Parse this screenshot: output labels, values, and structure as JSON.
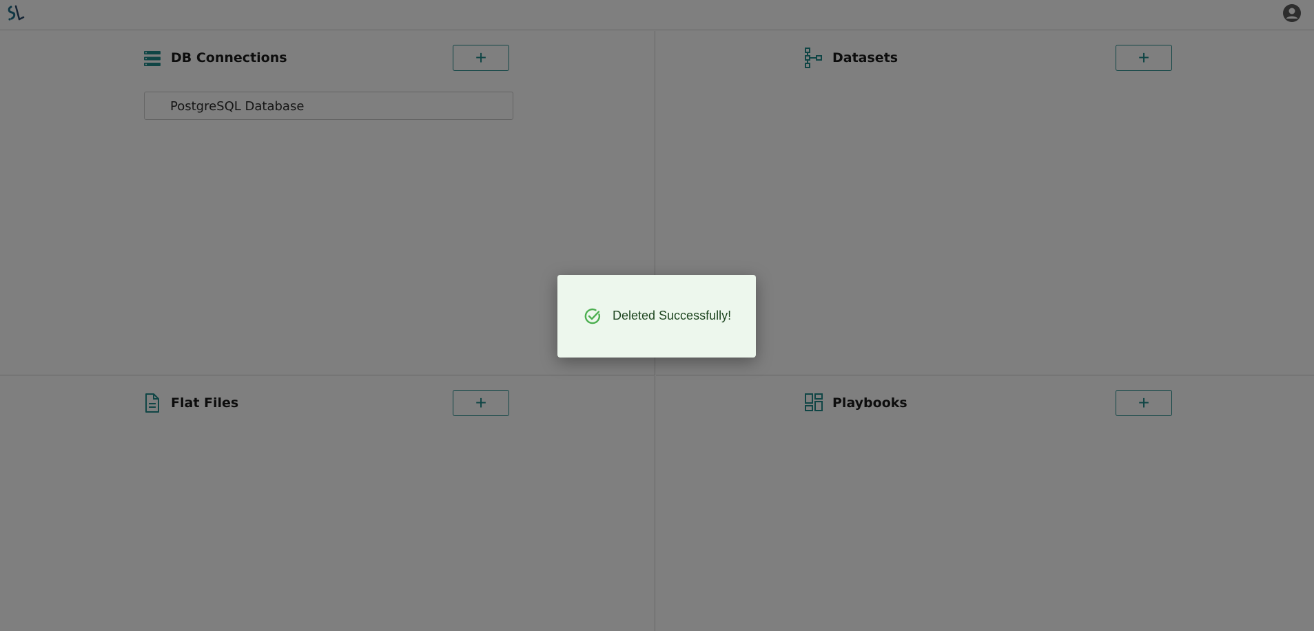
{
  "header": {
    "logo_icon": "app-logo-icon",
    "account_icon": "account-circle-icon"
  },
  "sections": {
    "db_connections": {
      "title": "DB Connections",
      "icon": "storage-icon",
      "add_label": "+",
      "items": [
        {
          "label": "PostgreSQL Database"
        }
      ]
    },
    "datasets": {
      "title": "Datasets",
      "icon": "hierarchy-icon",
      "add_label": "+"
    },
    "flat_files": {
      "title": "Flat Files",
      "icon": "document-icon",
      "add_label": "+"
    },
    "playbooks": {
      "title": "Playbooks",
      "icon": "dashboard-icon",
      "add_label": "+"
    }
  },
  "toast": {
    "message": "Deleted Successfully!",
    "icon": "check-circle-icon",
    "severity": "success"
  },
  "colors": {
    "accent": "#1f8a8a",
    "toast_bg": "#edf7ed",
    "toast_text": "#1e4620",
    "toast_icon": "#4caf50",
    "overlay": "rgba(0,0,0,0.5)"
  }
}
